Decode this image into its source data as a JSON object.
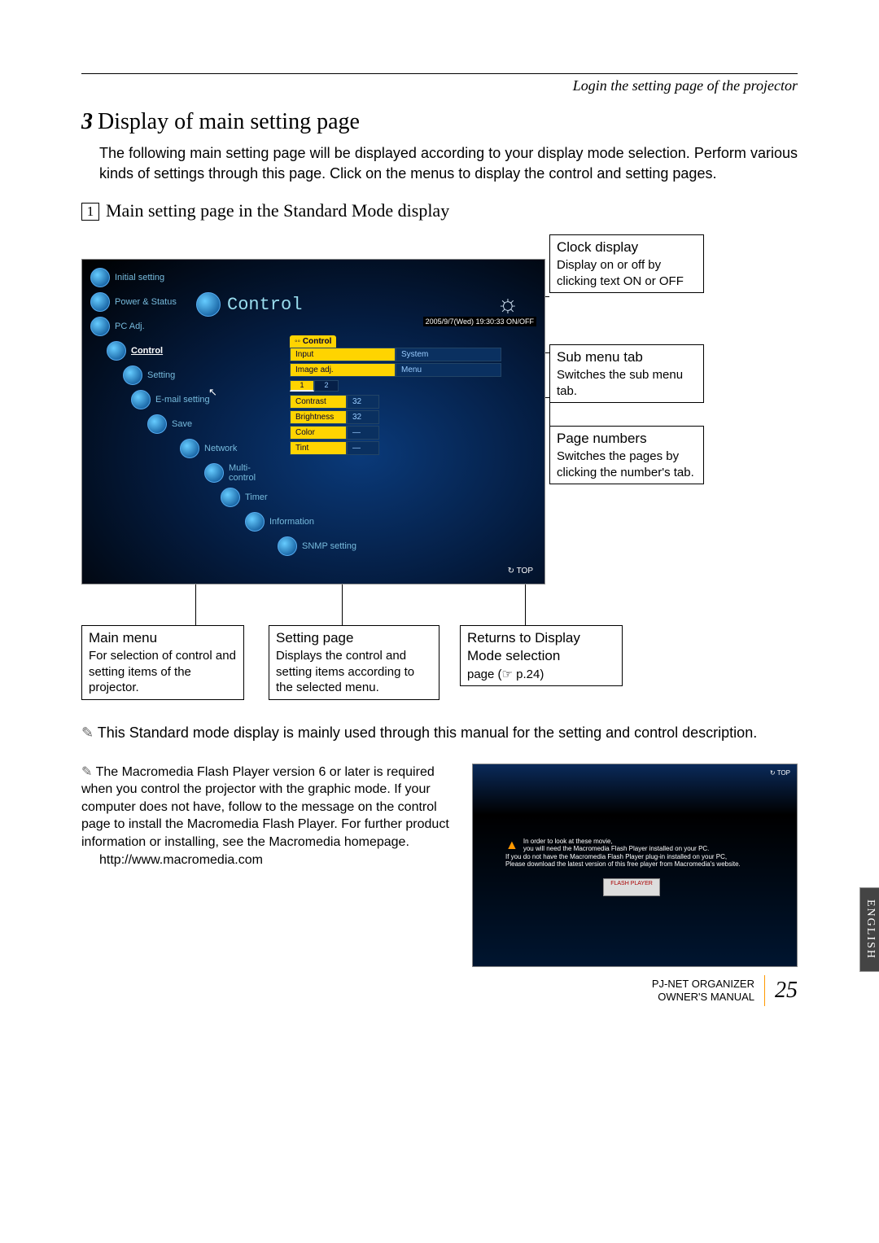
{
  "header": {
    "breadcrumb": "Login the setting page of the projector"
  },
  "section": {
    "num": "3",
    "title": "Display of main setting page",
    "body": "The following main setting page will be displayed according to your display mode selection. Perform various kinds of settings through this page. Click on the menus to display the control and setting pages."
  },
  "subsection": {
    "num": "1",
    "title": "Main setting page in the Standard Mode display"
  },
  "screenshot": {
    "sidebar": [
      "Initial setting",
      "Power & Status",
      "PC Adj.",
      "Control",
      "Setting",
      "E-mail setting",
      "Save",
      "Network",
      "Multi-control",
      "Timer",
      "Information",
      "SNMP setting"
    ],
    "title": "Control",
    "infobar": "2005/9/7(Wed) 19:30:33 ON/OFF",
    "panel_tab": "Control",
    "rows": [
      {
        "a": "Input",
        "b": "System"
      },
      {
        "a": "Image adj.",
        "b": "Menu"
      }
    ],
    "pagenums": [
      "1",
      "2"
    ],
    "params": [
      {
        "label": "Contrast",
        "value": "32"
      },
      {
        "label": "Brightness",
        "value": "32"
      },
      {
        "label": "Color",
        "value": "—"
      },
      {
        "label": "Tint",
        "value": "—"
      }
    ],
    "top": "TOP"
  },
  "callouts": {
    "clock": {
      "title": "Clock display",
      "body": "Display on or off by clicking text ON or OFF"
    },
    "submenu": {
      "title": "Sub menu tab",
      "body": "Switches the sub menu tab."
    },
    "pagenums": {
      "title": "Page numbers",
      "body": "Switches the pages by clicking the number's tab."
    },
    "mainmenu": {
      "title": "Main menu",
      "body": "For selection of control and setting items of the projector."
    },
    "settingpage": {
      "title": "Setting page",
      "body": "Displays the control and setting items according to the selected menu."
    },
    "returns": {
      "title": "Returns to Display Mode selection",
      "body": "page (☞ p.24)"
    }
  },
  "notes": {
    "n1": "This Standard mode display is mainly used through this manual for the setting and control description.",
    "n2a": "The Macromedia Flash Player version 6 or later is required when you control the projector with the graphic mode. If your computer does not have, follow to the message on the control page to install the Macromedia Flash Player. For further product information or installing, see the Macromedia homepage.",
    "n2b": "http://www.macromedia.com"
  },
  "flash": {
    "top": "↻ TOP",
    "line1": "In order to look at these movie,",
    "line2": "you will need the Macromedia Flash Player installed on your PC.",
    "line3": "If you do not have the Macromedia Flash Player plug-in installed on your PC,",
    "line4": "Please download the latest version of this free player from Macromedia's website.",
    "button": "FLASH PLAYER"
  },
  "sidebar_tab": "ENGLISH",
  "footer": {
    "line1": "PJ-NET ORGANIZER",
    "line2": "OWNER'S MANUAL",
    "page": "25"
  }
}
